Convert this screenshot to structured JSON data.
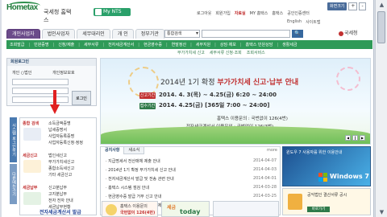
{
  "header": {
    "logo_text": "Hometax",
    "logo_sub": "국세청 홈택스",
    "mynts": "My NTS",
    "utilbar": [
      "화면크기",
      "+",
      "-"
    ],
    "toplinks": [
      {
        "label": "로그아웃",
        "hl": false
      },
      {
        "label": "회원가입",
        "hl": false
      },
      {
        "label": "자료실",
        "hl": true
      },
      {
        "label": "MY 홈택스",
        "hl": false
      },
      {
        "label": "홈택스",
        "hl": false
      },
      {
        "label": "공인인증센터",
        "hl": false
      }
    ],
    "toplinks2": [
      "English",
      "사이트맵"
    ],
    "brand_right": "국세청"
  },
  "tabs": [
    {
      "label": "개인사업자",
      "active": true
    },
    {
      "label": "법인사업자",
      "active": false
    },
    {
      "label": "세무대리인",
      "active": false
    },
    {
      "label": "개 인",
      "active": false
    },
    {
      "label": "정부기관",
      "active": false
    }
  ],
  "search": {
    "scope": "통합검색",
    "button": "🔍"
  },
  "navbar": [
    "조회발급",
    "민원증명",
    "신청/제출",
    "세무서류",
    "전자세금계산서",
    "현금영수증",
    "연말정산",
    "세무지원",
    "상담·제보",
    "홈택스 민원상담",
    "생활세금"
  ],
  "subnav": [
    "부가가치세 신고",
    "세무서류 신청·조회",
    "조회서비스"
  ],
  "login": {
    "title": "회원로그인",
    "opt1": "개인 ○법인",
    "opt2": "개인정보보호",
    "id_label": "",
    "button": "로그인"
  },
  "vtabs": [
    "시스템 로그인하기",
    "다른메뉴가기"
  ],
  "menu": {
    "groups": [
      {
        "title": "종합 검색",
        "items": [
          "소득금액증명",
          "납세증명서",
          "사업자등록증명",
          "사업자등록신청·정정"
        ]
      },
      {
        "title": "세금신고",
        "items": [
          "법인세신고",
          "부가가치세신고",
          "종합소득세신고",
          "기타 세금신고"
        ]
      },
      {
        "title": "세금납부",
        "items": [
          "신고분납부",
          "고지분납부",
          "전자 전자 안내",
          "세금납부현황"
        ]
      }
    ],
    "highlight": "전자세금계산서 발급"
  },
  "banner": {
    "title_prefix": "2014년 1기 확정",
    "title_main": "부가가치세 신고·납부 안내",
    "tag1": "신고기간",
    "line1": "2014. 4. 3(목) ~ 4.25(금) 6:20 ~ 24:00",
    "tag2": "접수기간",
    "line2": "2014. 4.25(금) [365일 7:00 ~ 24:00]",
    "bullet1": "홈택스 이용문의 : 국번없이 126(4번)",
    "bullet2": "전자세금계산서 이용문의 : 국번없이 126(3번)",
    "pill1": "국번없이 126(4번)",
    "pill2": "국번없이 126(3번)"
  },
  "notice": {
    "tabs": [
      "공지사항",
      "새소식"
    ],
    "more": "more",
    "rows": [
      {
        "text": "· 지급명세서 전산매체 제출 안내",
        "date": "2014-04-07"
      },
      {
        "text": "· 2014년 1기 확정 부가가치세 신고 안내",
        "date": "2014-04-03"
      },
      {
        "text": "· 전자세금계산서 발급 및 전송 관련 안내",
        "date": "2014-04-01"
      },
      {
        "text": "· 홈택스 시스템 점검 안내",
        "date": "2014-03-28"
      },
      {
        "text": "· 현금영수증 발급 거부 신고 안내",
        "date": "2014-03-25"
      },
      {
        "text": "· 연말정산 간소화 서비스 자료 제공 안내",
        "date": "2014-03-20"
      }
    ]
  },
  "win7": {
    "text": "윈도우 7 사용자를 위한 이용안내",
    "logo": "Windows 7"
  },
  "corp": {
    "text": "공익법인 결산서류 공시",
    "button": "바로가기"
  },
  "cards": [
    {
      "text": "홈택스 이용문의",
      "sub": "국번없이 126(4번)"
    },
    {
      "text": "세금",
      "sub": "today"
    },
    {
      "text": "",
      "sub": ""
    }
  ],
  "colors": {
    "green": "#2f9a58",
    "purple": "#6b4b8a",
    "red": "#c13030",
    "blue": "#36689e"
  }
}
